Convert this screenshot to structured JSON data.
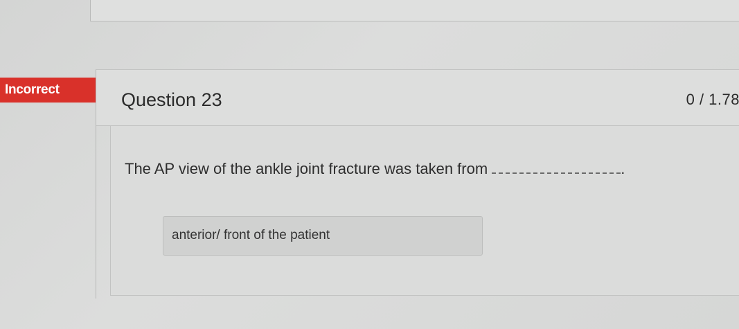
{
  "status": {
    "label": "Incorrect",
    "color": "#d9312a"
  },
  "question": {
    "title": "Question 23",
    "score": "0 / 1.78",
    "prompt": "The AP view of the ankle joint fracture was taken from",
    "end_punctuation": "."
  },
  "answer": {
    "value": "anterior/ front of the patient"
  }
}
